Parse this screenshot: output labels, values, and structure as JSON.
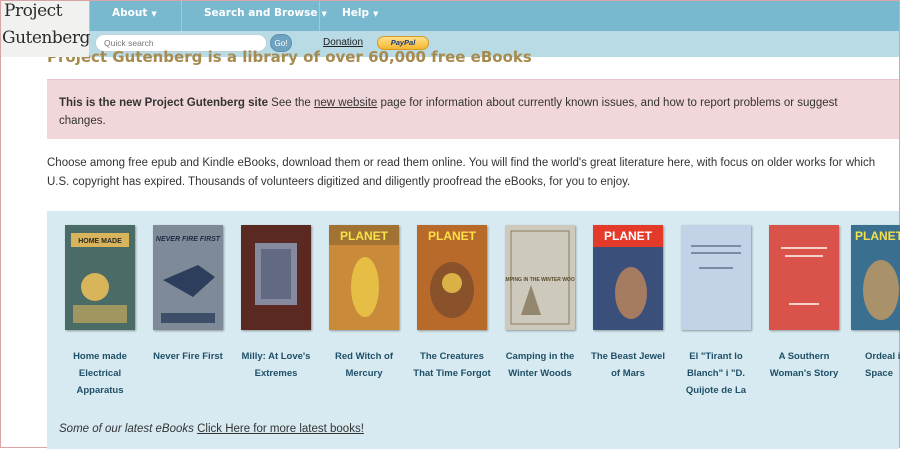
{
  "header": {
    "logo_line1": "Project",
    "logo_line2": "Gutenberg",
    "nav": [
      {
        "label": "About"
      },
      {
        "label": "Search and Browse"
      },
      {
        "label": "Help"
      }
    ],
    "search_placeholder": "Quick search",
    "go_label": "Go!",
    "donation_label": "Donation",
    "paypal_label": "PayPal"
  },
  "page_title": "Project Gutenberg is a library of over 60,000 free eBooks",
  "notice": {
    "bold": "This is the new Project Gutenberg site",
    "pre_link": " See the ",
    "link": "new website",
    "post_link": " page for information about currently known issues, and how to report problems or suggest changes."
  },
  "intro": "Choose among free epub and Kindle eBooks, download them or read them online. You will find the world's great literature here, with focus on older works for which U.S. copyright has expired. Thousands of volunteers digitized and diligently proofread the eBooks, for you to enjoy.",
  "books": [
    {
      "title": "Home made Electrical Apparatus",
      "cover_color": "#4a6b66",
      "accent": "#d8b45a",
      "cover_text": "HOME MADE"
    },
    {
      "title": "Never Fire First",
      "cover_color": "#7f8a99",
      "accent": "#2d3e5c",
      "cover_text": "NEVER FIRE FIRST"
    },
    {
      "title": "Milly: At Love's Extremes",
      "cover_color": "#5a2a22",
      "accent": "#8e9bb5",
      "cover_text": ""
    },
    {
      "title": "Red Witch of Mercury",
      "cover_color": "#c98a3a",
      "accent": "#f2d34a",
      "cover_text": "PLANET"
    },
    {
      "title": "The Creatures That Time Forgot",
      "cover_color": "#b86a2a",
      "accent": "#e9c24a",
      "cover_text": "PLANET"
    },
    {
      "title": "Camping in the Winter Woods",
      "cover_color": "#cdc9bd",
      "accent": "#6b5a3a",
      "cover_text": "CAMPING IN THE WINTER WOODS"
    },
    {
      "title": "The Beast Jewel of Mars",
      "cover_color": "#3a4f7a",
      "accent": "#e43a2a",
      "cover_text": "PLANET"
    },
    {
      "title": "El \"Tirant lo Blanch\" i \"D. Quijote de La",
      "cover_color": "#c3d2e6",
      "accent": "#7d8aa3",
      "cover_text": ""
    },
    {
      "title": "A Southern Woman's Story",
      "cover_color": "#d9534a",
      "accent": "#f4d0c8",
      "cover_text": ""
    },
    {
      "title": "Ordeal in Space",
      "cover_color": "#3b6f8f",
      "accent": "#e3362b",
      "cover_text": "PLANET"
    }
  ],
  "latest": {
    "prefix": "Some of our latest eBooks ",
    "link": "Click Here for more latest books!"
  },
  "colors": {
    "header_bar": "#78b9cf",
    "sub_bar": "#b9dbe6",
    "notice_bg": "#f2d7da",
    "books_bg": "#d7eaf1",
    "title_gold": "#a68a4e"
  }
}
